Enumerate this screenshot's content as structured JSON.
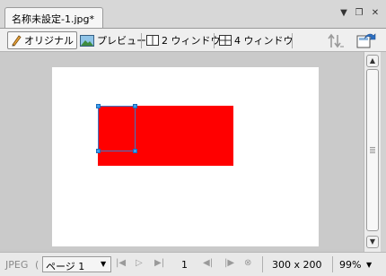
{
  "document_tab": {
    "title": "名称未設定-1.jpg*"
  },
  "window_controls": {
    "dropdown_glyph": "▼",
    "restore_glyph": "❐",
    "close_glyph": "✕"
  },
  "toolbar": {
    "original_label": "オリジナル",
    "preview_label": "プレビュー",
    "two_window_label": "2 ウィンドウ",
    "four_window_label": "4 ウィンドウ"
  },
  "scrollbar": {
    "up_glyph": "▲",
    "down_glyph": "▼"
  },
  "status_bar": {
    "format": "JPEG",
    "page_select": "ページ 1",
    "first_glyph": "|◀",
    "prev_glyph": "▷",
    "next_glyph": "▶|",
    "page_number": "1",
    "back_frame_glyph": "◀|",
    "fwd_frame_glyph": "|▶",
    "loop_glyph": "⊗",
    "image_size": "300 x 200",
    "zoom": "99%"
  },
  "colors": {
    "accent": "#ff0000",
    "selection": "#3b79c7",
    "handle": "#3e9df0"
  }
}
